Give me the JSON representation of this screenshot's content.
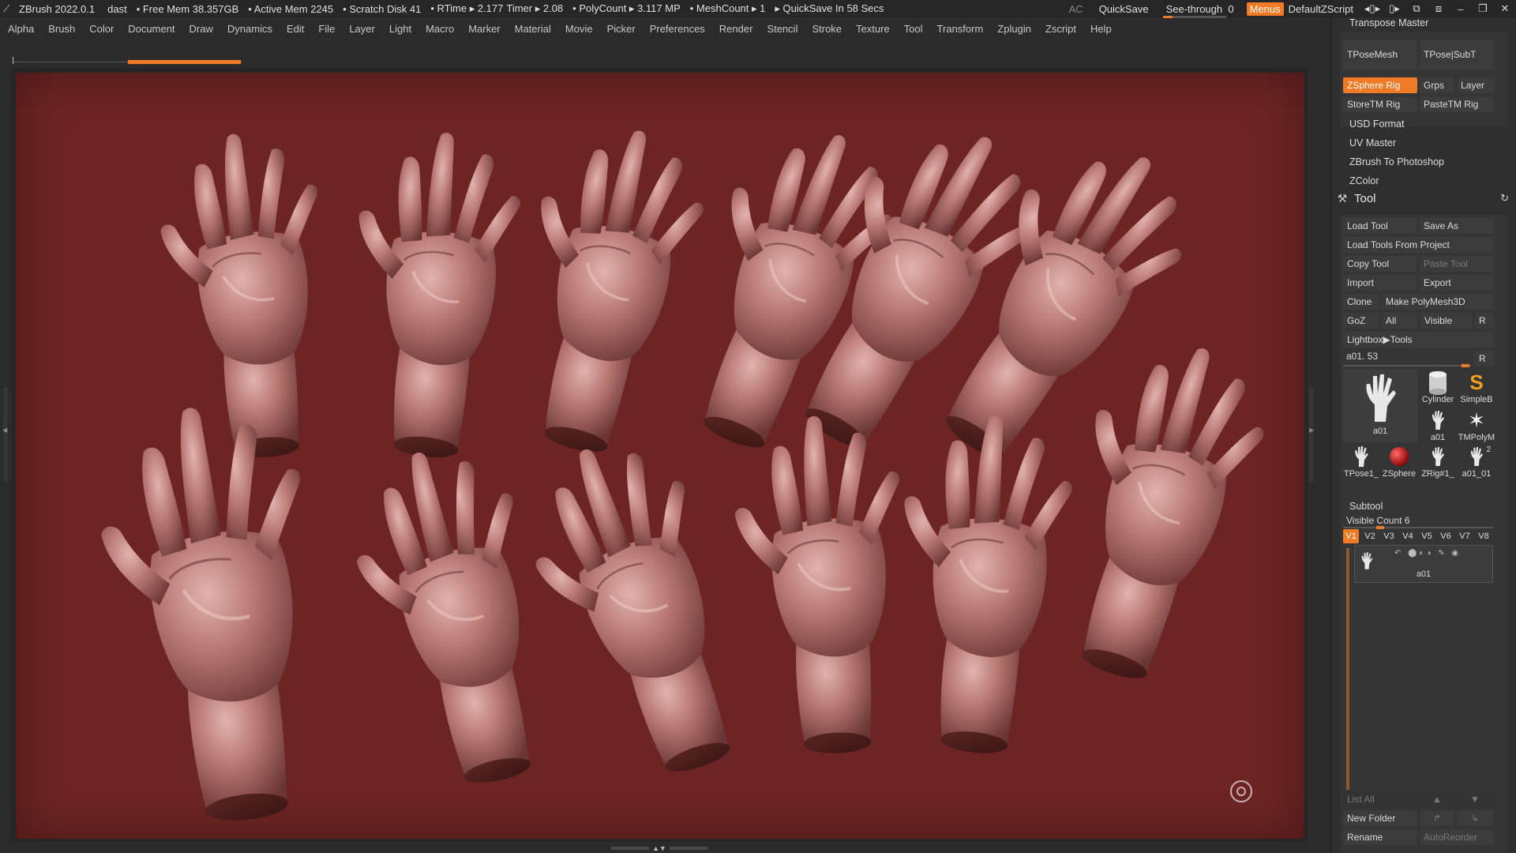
{
  "titlebar": {
    "app": "ZBrush 2022.0.1",
    "doc": "dast",
    "free_mem": "• Free Mem 38.357GB",
    "active_mem": "• Active Mem 2245",
    "scratch": "• Scratch Disk 41",
    "rtime": "• RTime ▸ 2.177",
    "timer": "Timer ▸ 2.08",
    "polycount": "• PolyCount ▸ 3.117 MP",
    "meshcount": "• MeshCount ▸ 1",
    "quicksave_status": "▸ QuickSave In 58 Secs",
    "ac": "AC",
    "quicksave": "QuickSave",
    "see_through_label": "See-through",
    "see_through_value": "0",
    "menus": "Menus",
    "script": "DefaultZScript",
    "accent_color": "#f07a26"
  },
  "menubar": [
    "Alpha",
    "Brush",
    "Color",
    "Document",
    "Draw",
    "Dynamics",
    "Edit",
    "File",
    "Layer",
    "Light",
    "Macro",
    "Marker",
    "Material",
    "Movie",
    "Picker",
    "Preferences",
    "Render",
    "Stencil",
    "Stroke",
    "Texture",
    "Tool",
    "Transform",
    "Zplugin",
    "Zscript",
    "Help"
  ],
  "canvas": {
    "background": "#6d2523",
    "hand_count": 12
  },
  "palette": {
    "transpose_master": "Transpose Master",
    "tposemesh": "TPoseMesh",
    "tpose_subt": "TPose|SubT",
    "zsphere_rig": "ZSphere Rig",
    "grps": "Grps",
    "layer": "Layer",
    "store_tm_rig": "StoreTM Rig",
    "paste_tm_rig": "PasteTM Rig",
    "usd_format": "USD Format",
    "uv_master": "UV Master",
    "zbrush_to_photoshop": "ZBrush To Photoshop",
    "zcolor": "ZColor",
    "tool_title": "Tool",
    "load_tool": "Load Tool",
    "save_as": "Save As",
    "load_tools_from_project": "Load Tools From Project",
    "copy_tool": "Copy Tool",
    "paste_tool": "Paste Tool",
    "import": "Import",
    "export": "Export",
    "clone": "Clone",
    "make_polymesh": "Make PolyMesh3D",
    "goz": "GoZ",
    "all": "All",
    "visible": "Visible",
    "r": "R",
    "lightbox_tools": "Lightbox▶Tools",
    "current_tool": "a01. 53",
    "current_tool_r": "R",
    "thumbs": {
      "main": "a01",
      "cylinder": "Cylinder",
      "simpleb": "SimpleB",
      "a01_small": "a01",
      "tmpoly": "TMPolyM",
      "tpose": "TPose1_",
      "zsphere": "ZSphere",
      "zrig": "ZRig#1_",
      "a01_01": "a01_01",
      "a01_01_count": "2"
    },
    "subtool": "Subtool",
    "visible_count": "Visible Count 6",
    "versions": [
      "V1",
      "V2",
      "V3",
      "V4",
      "V5",
      "V6",
      "V7",
      "V8"
    ],
    "subtool_item": "a01",
    "list_all": "List All",
    "new_folder": "New Folder",
    "rename": "Rename",
    "autoreorder": "AutoReorder"
  }
}
